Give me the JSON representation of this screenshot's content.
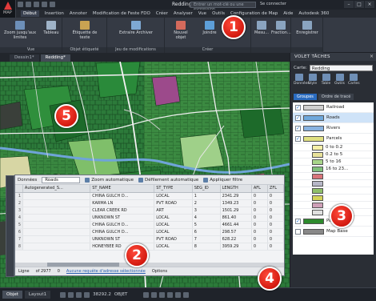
{
  "window": {
    "document_title": "Redding.dwg",
    "search_placeholder": "Entrer un mot-clé ou une expression",
    "signin": "Se connecter",
    "app_label": "MAP"
  },
  "menu": {
    "tabs": [
      "Début",
      "Insertion",
      "Annoter",
      "Modification de Feste FDO",
      "Créer",
      "Analyser",
      "Vue",
      "Outils",
      "Configuration de Map",
      "Aide",
      "Autodesk 360"
    ],
    "active_index": 0
  },
  "ribbon": {
    "groups": [
      {
        "label": "Vue",
        "buttons": [
          "Zoom jusqu'aux limites",
          "Tableau"
        ]
      },
      {
        "label": "Objet étiqueté",
        "buttons": [
          "Étiquette de texte"
        ]
      },
      {
        "label": "Jeu de modifications",
        "buttons": [
          "Extraire Archiver"
        ]
      },
      {
        "label": "Créer",
        "buttons": [
          "Nouvel objet",
          "Joindre"
        ]
      },
      {
        "label": "",
        "buttons": [
          "Mesu...",
          "Fraction..."
        ]
      },
      {
        "label": "",
        "buttons": [
          "Enregistrer"
        ]
      }
    ]
  },
  "doc_tabs": [
    "Dessin1*",
    "Redding*"
  ],
  "data_table": {
    "layer_select": "Roads",
    "layer_prefix": "Données",
    "toolbar": [
      "Zoom automatique",
      "Défilement automatique",
      "Appliquer filtre"
    ],
    "columns": [
      "",
      "Autogenerated_S...",
      "ST_NAME",
      "ST_TYPE",
      "SEG_ID",
      "LENGTH",
      "AFL",
      "ZFL"
    ],
    "rows": [
      [
        "1",
        "",
        "CHINA GULCH D...",
        "LOCAL",
        "1",
        "2341.29",
        "0",
        "0"
      ],
      [
        "2",
        "",
        "KARMA LN",
        "PVT ROAD",
        "2",
        "1349.23",
        "0",
        "0"
      ],
      [
        "3",
        "",
        "CLEAR CREEK RD",
        "ART",
        "3",
        "1501.29",
        "0",
        "0"
      ],
      [
        "4",
        "",
        "UNKNOWN ST",
        "LOCAL",
        "4",
        "861.40",
        "0",
        "0"
      ],
      [
        "5",
        "",
        "CHINA GULCH D...",
        "LOCAL",
        "5",
        "4661.44",
        "0",
        "0"
      ],
      [
        "6",
        "",
        "CHINA GULCH D...",
        "LOCAL",
        "6",
        "298.57",
        "0",
        "0"
      ],
      [
        "7",
        "",
        "UNKNOWN ST",
        "PVT ROAD",
        "7",
        "628.22",
        "0",
        "0"
      ],
      [
        "8",
        "",
        "HONEYBEE RD",
        "LOCAL",
        "8",
        "3959.29",
        "0",
        "0"
      ]
    ],
    "status": {
      "prefix": "Ligne",
      "count": "of 2977",
      "zero": "0",
      "link": "Aucune requête d'adresse sélectionnée",
      "options": "Options"
    }
  },
  "panel": {
    "title": "VOLET TÂCHES",
    "map_label": "Carte:",
    "map_value": "Redding",
    "tools": [
      "Données",
      "Style",
      "Table",
      "Outils",
      "Cartes"
    ],
    "tabs": [
      "Groupes",
      "Ordre de tracé"
    ],
    "layers": [
      {
        "name": "Railroad",
        "checked": true,
        "color": "#cfcfcf"
      },
      {
        "name": "Roads",
        "checked": true,
        "color": "#6fa8dc",
        "selected": true
      },
      {
        "name": "Rivers",
        "checked": true,
        "color": "#88b2e0"
      },
      {
        "name": "Parcels",
        "checked": true,
        "color": "#e0e080"
      },
      {
        "name": "Parks",
        "checked": true,
        "color": "#2d8a2d"
      },
      {
        "name": "Map Base",
        "checked": false,
        "color": "#888888"
      }
    ],
    "parcel_classes": [
      {
        "label": "0 to 0.2",
        "color": "#f6f0a8"
      },
      {
        "label": "0.2 to 5",
        "color": "#e8e29a"
      },
      {
        "label": "5 to 16",
        "color": "#a8d58a"
      },
      {
        "label": "16 to 23...",
        "color": "#7fbf7b"
      },
      {
        "label": "",
        "color": "#d8747a"
      },
      {
        "label": "",
        "color": "#b7b7c7"
      },
      {
        "label": "",
        "color": "#8fbf6a"
      },
      {
        "label": "",
        "color": "#d4d45a"
      },
      {
        "label": "",
        "color": "#cfa0b8"
      },
      {
        "label": "",
        "color": "#e0e0e0"
      }
    ]
  },
  "status_bar": {
    "tabs": [
      "Objet",
      "Layout1"
    ],
    "coords": "38292.2",
    "scale": "OBJET"
  },
  "callouts": [
    "1",
    "2",
    "3",
    "4",
    "5"
  ]
}
